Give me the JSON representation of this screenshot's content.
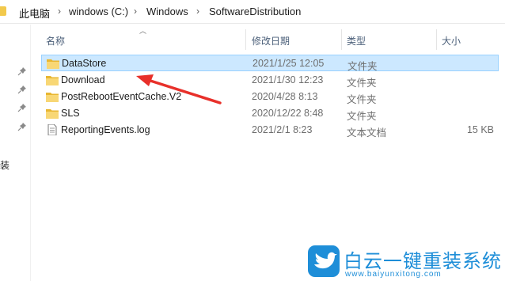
{
  "breadcrumb": {
    "items": [
      "此电脑",
      "windows (C:)",
      "Windows",
      "SoftwareDistribution"
    ],
    "separator": "›"
  },
  "sidebar": {
    "partial_label": "装"
  },
  "columns": {
    "name": "名称",
    "date": "修改日期",
    "type": "类型",
    "size": "大小"
  },
  "files": [
    {
      "name": "DataStore",
      "date": "2021/1/25 12:05",
      "type": "文件夹",
      "size": "",
      "icon": "folder-icon",
      "selected": true
    },
    {
      "name": "Download",
      "date": "2021/1/30 12:23",
      "type": "文件夹",
      "size": "",
      "icon": "folder-icon",
      "selected": false
    },
    {
      "name": "PostRebootEventCache.V2",
      "date": "2020/4/28 8:13",
      "type": "文件夹",
      "size": "",
      "icon": "folder-icon",
      "selected": false
    },
    {
      "name": "SLS",
      "date": "2020/12/22 8:48",
      "type": "文件夹",
      "size": "",
      "icon": "folder-icon",
      "selected": false
    },
    {
      "name": "ReportingEvents.log",
      "date": "2021/2/1 8:23",
      "type": "文本文档",
      "size": "15 KB",
      "icon": "text-file-icon",
      "selected": false
    }
  ],
  "watermark": {
    "title": "白云一键重装系统",
    "url": "www.baiyunxitong.com"
  },
  "colors": {
    "selection_bg": "#cce8ff",
    "selection_border": "#99d1ff",
    "folder": "#f2c94c",
    "arrow": "#e8302a",
    "watermark": "#1e8ed8"
  }
}
